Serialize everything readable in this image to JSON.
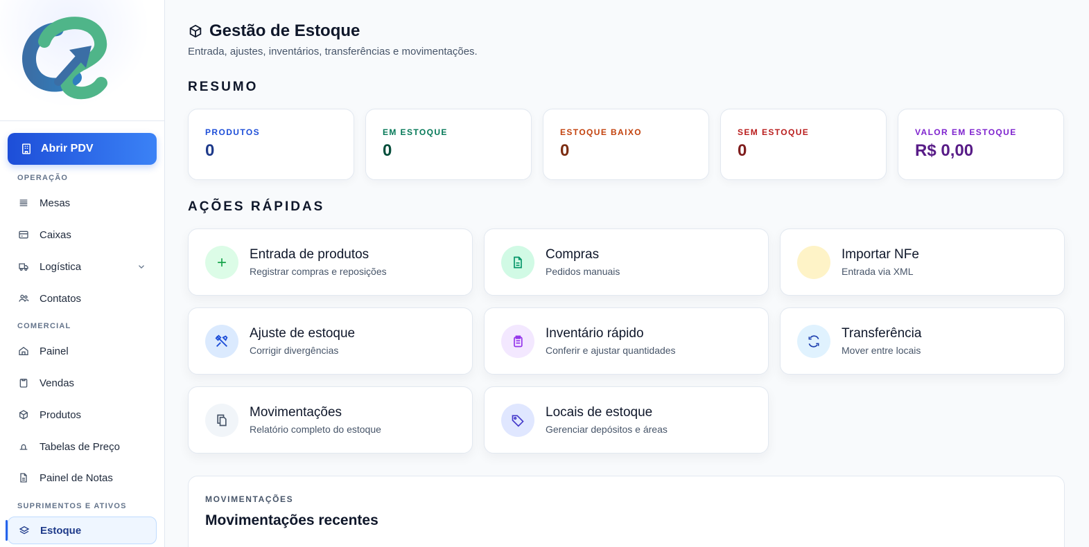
{
  "sidebar": {
    "pdv_label": "Abrir PDV",
    "sections": {
      "operacao": "OPERAÇÃO",
      "comercial": "COMERCIAL",
      "suprimentos": "SUPRIMENTOS E ATIVOS"
    },
    "items": {
      "mesas": "Mesas",
      "caixas": "Caixas",
      "logistica": "Logística",
      "contatos": "Contatos",
      "painel": "Painel",
      "vendas": "Vendas",
      "produtos": "Produtos",
      "tabelas": "Tabelas de Preço",
      "notas": "Painel de Notas",
      "estoque": "Estoque"
    }
  },
  "header": {
    "title": "Gestão de Estoque",
    "subtitle": "Entrada, ajustes, inventários, transferências e movimentações."
  },
  "summary": {
    "heading": "RESUMO",
    "cards": [
      {
        "label": "PRODUTOS",
        "value": "0",
        "color": "#1e40af"
      },
      {
        "label": "EM ESTOQUE",
        "value": "0",
        "color": "#047857"
      },
      {
        "label": "ESTOQUE BAIXO",
        "value": "0",
        "color": "#c2410c"
      },
      {
        "label": "SEM ESTOQUE",
        "value": "0",
        "color": "#b91c1c"
      },
      {
        "label": "VALOR EM ESTOQUE",
        "value": "R$ 0,00",
        "color": "#7e22ce"
      }
    ]
  },
  "actions": {
    "heading": "AÇÕES RÁPIDAS",
    "items": [
      {
        "title": "Entrada de produtos",
        "subtitle": "Registrar compras e reposições"
      },
      {
        "title": "Compras",
        "subtitle": "Pedidos manuais"
      },
      {
        "title": "Importar NFe",
        "subtitle": "Entrada via XML"
      },
      {
        "title": "Ajuste de estoque",
        "subtitle": "Corrigir divergências"
      },
      {
        "title": "Inventário rápido",
        "subtitle": "Conferir e ajustar quantidades"
      },
      {
        "title": "Transferência",
        "subtitle": "Mover entre locais"
      },
      {
        "title": "Movimentações",
        "subtitle": "Relatório completo do estoque"
      },
      {
        "title": "Locais de estoque",
        "subtitle": "Gerenciar depósitos e áreas"
      }
    ]
  },
  "recent": {
    "kicker": "MOVIMENTAÇÕES",
    "title": "Movimentações recentes"
  }
}
